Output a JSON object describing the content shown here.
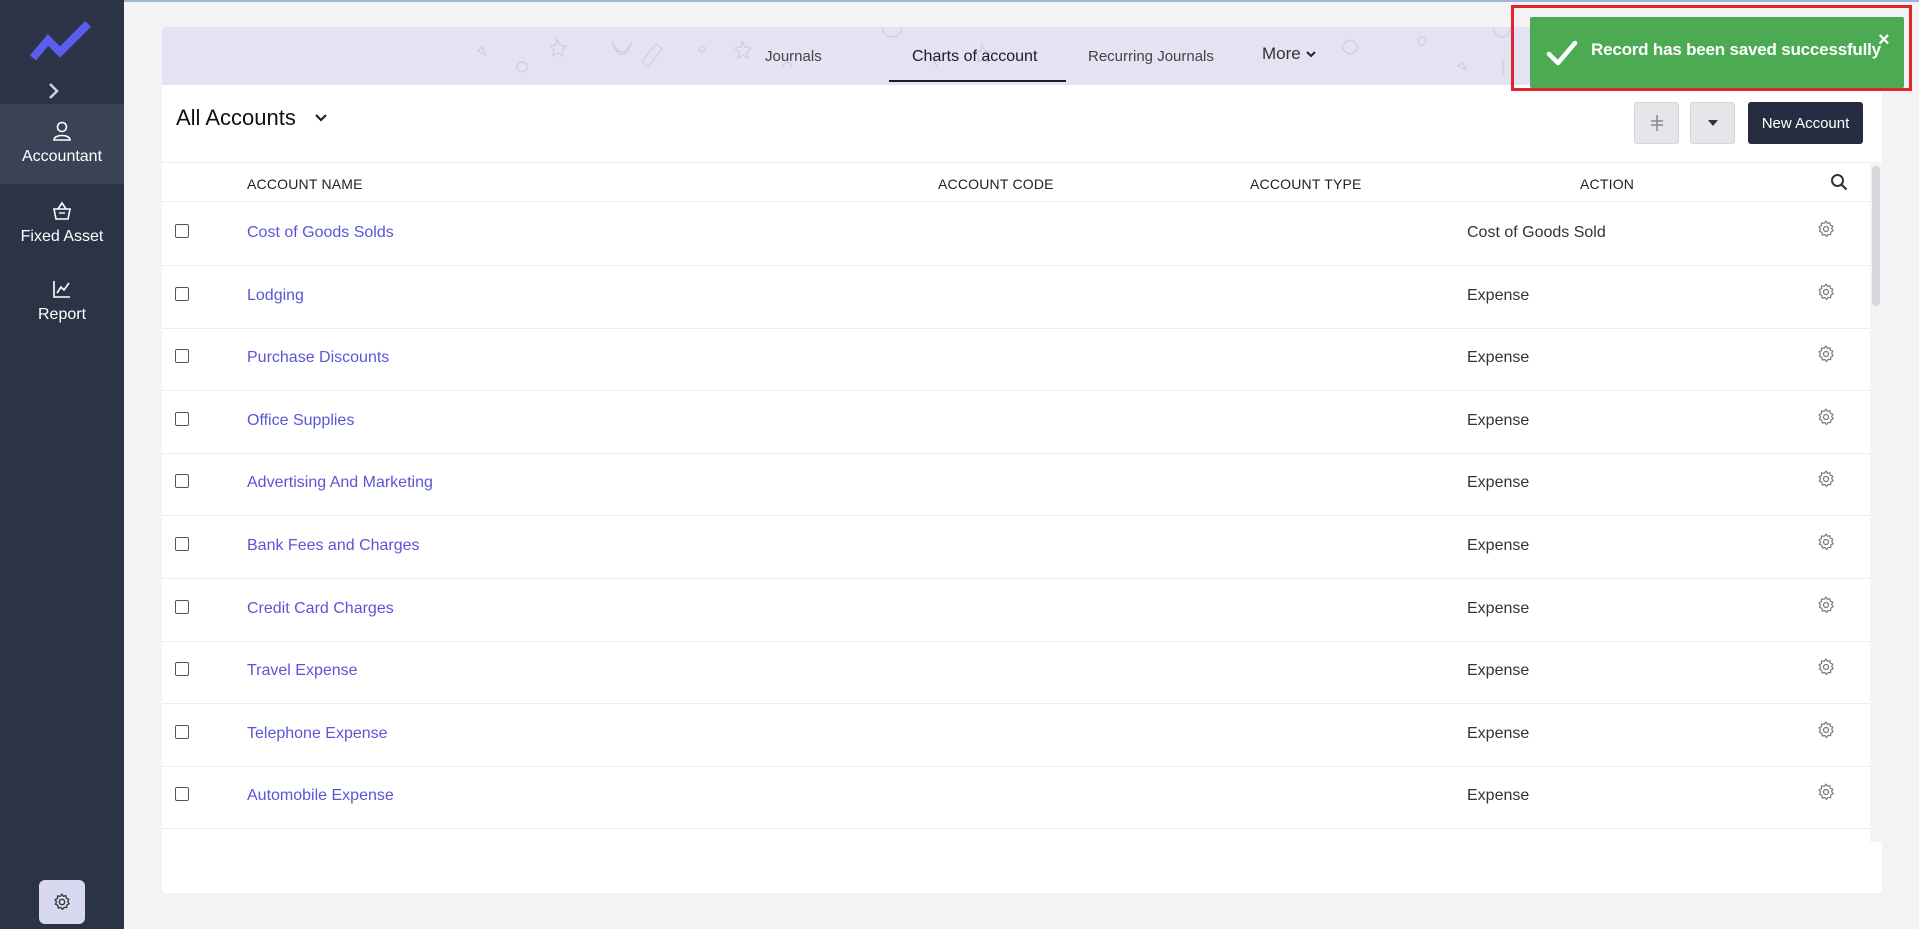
{
  "sidebar": {
    "items": [
      {
        "label": "Accountant",
        "icon": "user-icon",
        "active": true
      },
      {
        "label": "Fixed Asset",
        "icon": "basket-icon",
        "active": false
      },
      {
        "label": "Report",
        "icon": "chart-icon",
        "active": false
      }
    ]
  },
  "tabs": {
    "journals": "Journals",
    "charts": "Charts of account",
    "recurring": "Recurring Journals",
    "more": "More"
  },
  "filter": {
    "label": "All Accounts"
  },
  "toolbar": {
    "new_label": "New Account"
  },
  "table": {
    "headers": {
      "name": "ACCOUNT NAME",
      "code": "ACCOUNT CODE",
      "type": "ACCOUNT TYPE",
      "action": "ACTION"
    },
    "rows": [
      {
        "name": "Cost of Goods Solds",
        "type": "Cost of Goods Sold"
      },
      {
        "name": "Lodging",
        "type": "Expense"
      },
      {
        "name": "Purchase Discounts",
        "type": "Expense"
      },
      {
        "name": "Office Supplies",
        "type": "Expense"
      },
      {
        "name": "Advertising And Marketing",
        "type": "Expense"
      },
      {
        "name": "Bank Fees and Charges",
        "type": "Expense"
      },
      {
        "name": "Credit Card Charges",
        "type": "Expense"
      },
      {
        "name": "Travel Expense",
        "type": "Expense"
      },
      {
        "name": "Telephone Expense",
        "type": "Expense"
      },
      {
        "name": "Automobile Expense",
        "type": "Expense"
      }
    ]
  },
  "toast": {
    "message": "Record has been saved successfully",
    "close": "×",
    "color": "#4caa53"
  },
  "colors": {
    "sidebar": "#2b3447",
    "link": "#5b55d6",
    "primary_button": "#262d41"
  }
}
